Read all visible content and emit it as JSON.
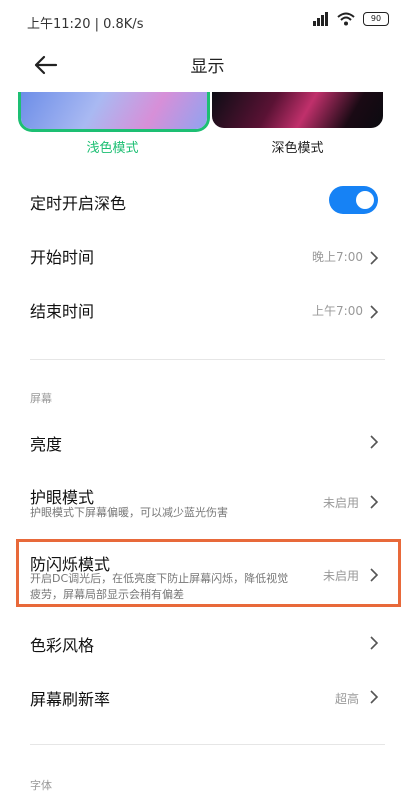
{
  "status": {
    "left_text": "上午11:20 | 0.8K/s",
    "battery": "90"
  },
  "header": {
    "title": "显示"
  },
  "theme": {
    "light_label": "浅色模式",
    "dark_label": "深色模式",
    "light_label_color": "#1dbf73"
  },
  "dark_schedule": {
    "label": "定时开启深色",
    "enabled": true,
    "start_label": "开始时间",
    "start_value": "晚上7:00",
    "end_label": "结束时间",
    "end_value": "上午7:00"
  },
  "screen": {
    "section_title": "屏幕",
    "brightness_label": "亮度",
    "eye_mode_label": "护眼模式",
    "eye_mode_desc": "护眼模式下屏幕偏暖，可以减少蓝光伤害",
    "eye_mode_value": "未启用",
    "dc_label": "防闪烁模式",
    "dc_desc_line1": "开启DC调光后，在低亮度下防止屏幕闪烁，降低视觉",
    "dc_desc_line2": "疲劳，屏幕局部显示会稍有偏差",
    "dc_value": "未启用",
    "color_style_label": "色彩风格",
    "refresh_label": "屏幕刷新率",
    "refresh_value": "超高"
  },
  "font": {
    "section_title": "字体"
  },
  "colors": {
    "accent": "#1682f5",
    "highlight": "#e8693a"
  }
}
